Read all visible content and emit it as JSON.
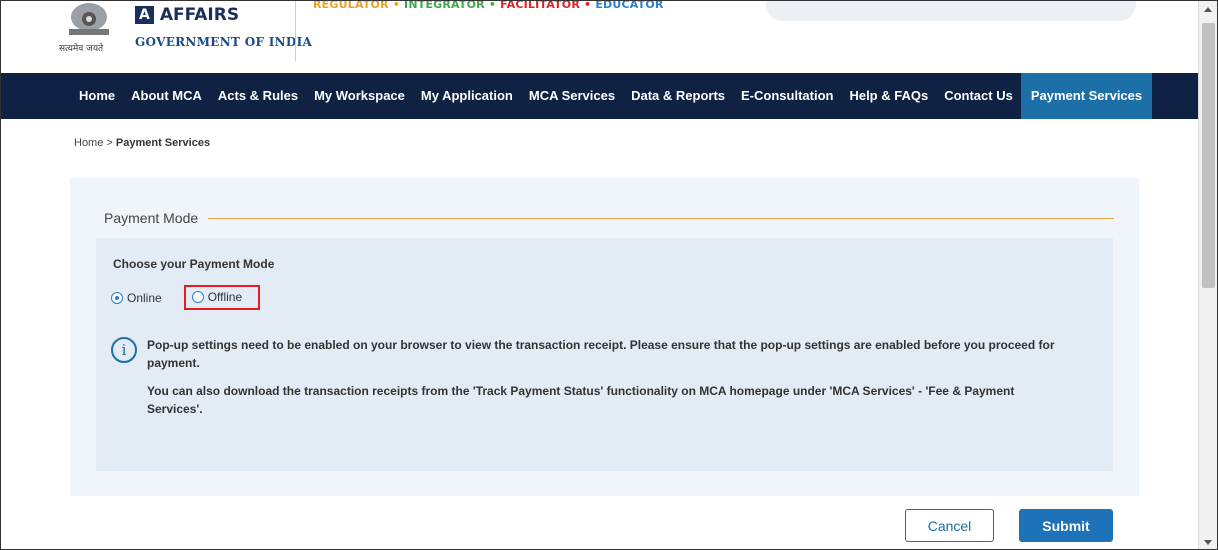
{
  "header": {
    "emblem_motto": "सत्यमेव जयते",
    "logo_a": "A",
    "logo_title": "AFFAIRS",
    "logo_subtitle": "GOVERNMENT OF INDIA",
    "tagline": [
      {
        "text": "REGULATOR",
        "color": "#f0a020"
      },
      {
        "text": " • ",
        "color": "#f0a020"
      },
      {
        "text": "INTEGRATOR",
        "color": "#3aa845"
      },
      {
        "text": " • ",
        "color": "#3aa845"
      },
      {
        "text": "FACILITATOR",
        "color": "#e02020"
      },
      {
        "text": " • ",
        "color": "#e02020"
      },
      {
        "text": "EDUCATOR",
        "color": "#2a7fd4"
      }
    ]
  },
  "nav": {
    "items": [
      "Home",
      "About MCA",
      "Acts & Rules",
      "My Workspace",
      "My Application",
      "MCA Services",
      "Data & Reports",
      "E-Consultation",
      "Help & FAQs",
      "Contact Us",
      "Payment Services"
    ],
    "active": "Payment Services"
  },
  "breadcrumb": {
    "home": "Home",
    "separator": " > ",
    "current": "Payment Services"
  },
  "payment": {
    "legend": "Payment Mode",
    "choose_label": "Choose your Payment Mode",
    "options": {
      "online": "Online",
      "offline": "Offline"
    },
    "selected": "Online",
    "info_icon": "info-icon",
    "info_line1": "Pop-up settings need to be enabled on your browser to view the transaction receipt. Please ensure that the pop-up settings are enabled before you proceed for payment.",
    "info_line2": "You can also download the transaction receipts from the 'Track Payment Status' functionality on MCA homepage under 'MCA Services' - 'Fee & Payment Services'."
  },
  "actions": {
    "cancel": "Cancel",
    "submit": "Submit"
  },
  "colors": {
    "nav_bg": "#0f2243",
    "nav_active": "#1d6fa8",
    "accent": "#1d72b8",
    "highlight_box": "#e02020"
  }
}
